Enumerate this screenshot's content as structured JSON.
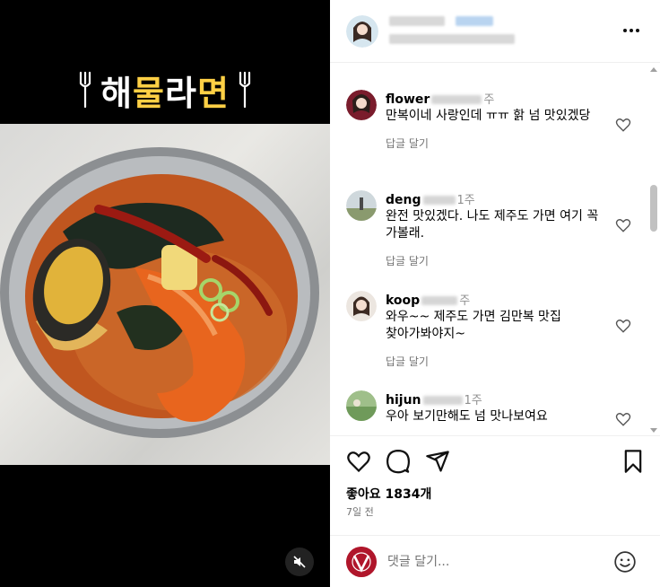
{
  "media": {
    "title_words": [
      "해",
      "물",
      "라",
      "면"
    ],
    "mute_icon": "muted-speaker-icon"
  },
  "header": {
    "more_icon": "more-dots-icon"
  },
  "comments": [
    {
      "username": "flower",
      "time": "주",
      "text": "만복이네 사랑인데 ㅠㅠ 핡 넘 맛있겠당",
      "reply": "답글 달기"
    },
    {
      "username": "deng",
      "time": "1주",
      "text": "완전 맛있겠다. 나도 제주도 가면 여기 꼭 가볼래.",
      "reply": "답글 달기"
    },
    {
      "username": "koop",
      "time": "주",
      "text": "와우~~ 제주도 가면 김만복 맛집 찾아가봐야지~",
      "reply": "답글 달기"
    },
    {
      "username": "hijun",
      "time": "1주",
      "text": "우아 보기만해도 넘 맛나보여요",
      "reply": ""
    }
  ],
  "actions": {
    "like_icon": "heart-icon",
    "comment_icon": "comment-bubble-icon",
    "share_icon": "paper-plane-icon",
    "save_icon": "bookmark-icon"
  },
  "likes_text": "좋아요 1834개",
  "date_text": "7일 전",
  "add_comment": {
    "placeholder": "댓글 달기...",
    "emoji_icon": "emoji-smile-icon"
  }
}
